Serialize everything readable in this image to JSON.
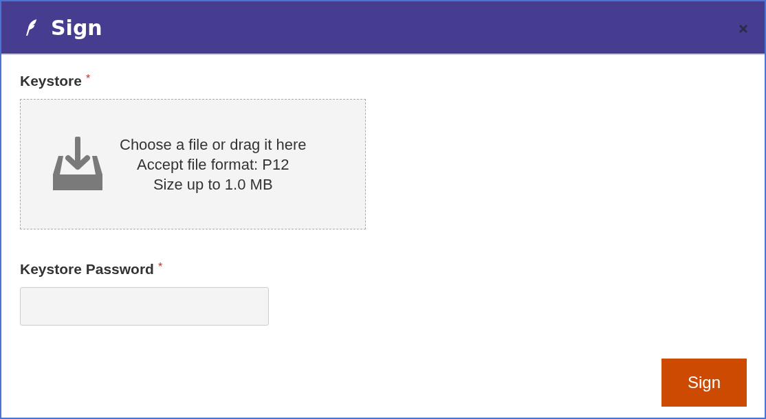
{
  "dialog": {
    "title": "Sign"
  },
  "fields": [
    {
      "kind": "upload",
      "label": "Keystore",
      "required_mark": "*",
      "lines": [
        "Choose a file or drag it here",
        "Accept file format: P12",
        "Size up to 1.0 MB"
      ]
    },
    {
      "kind": "password",
      "label": "Keystore Password",
      "required_mark": "*"
    }
  ],
  "buttons": [
    {
      "label": "Sign"
    }
  ]
}
